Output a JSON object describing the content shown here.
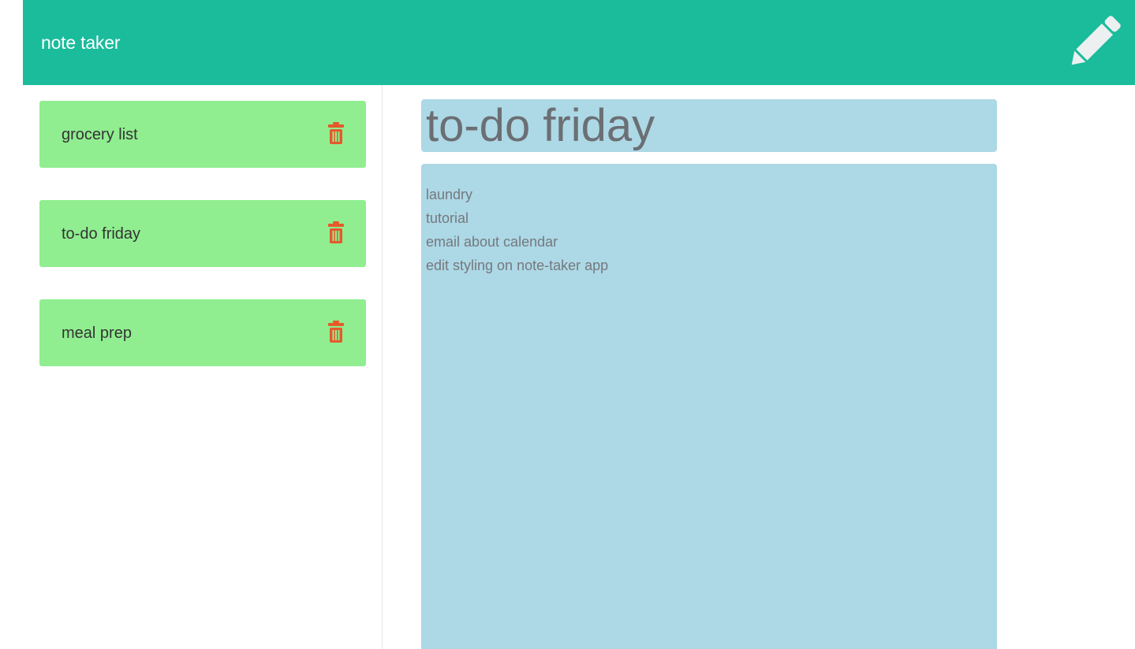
{
  "app": {
    "title": "note taker",
    "new_note_icon": "pencil-icon",
    "colors": {
      "navbar": "#1abc9c",
      "note_item": "#90ee90",
      "delete_icon": "#e55a2b",
      "editor": "#add8e6"
    }
  },
  "sidebar": {
    "notes": [
      {
        "title": "grocery list",
        "delete_icon": "trash-icon"
      },
      {
        "title": "to-do friday",
        "delete_icon": "trash-icon"
      },
      {
        "title": "meal prep",
        "delete_icon": "trash-icon"
      }
    ]
  },
  "editor": {
    "title": "to-do friday",
    "lines": [
      "laundry",
      "tutorial",
      "email about calendar",
      "edit styling on note-taker app"
    ]
  }
}
